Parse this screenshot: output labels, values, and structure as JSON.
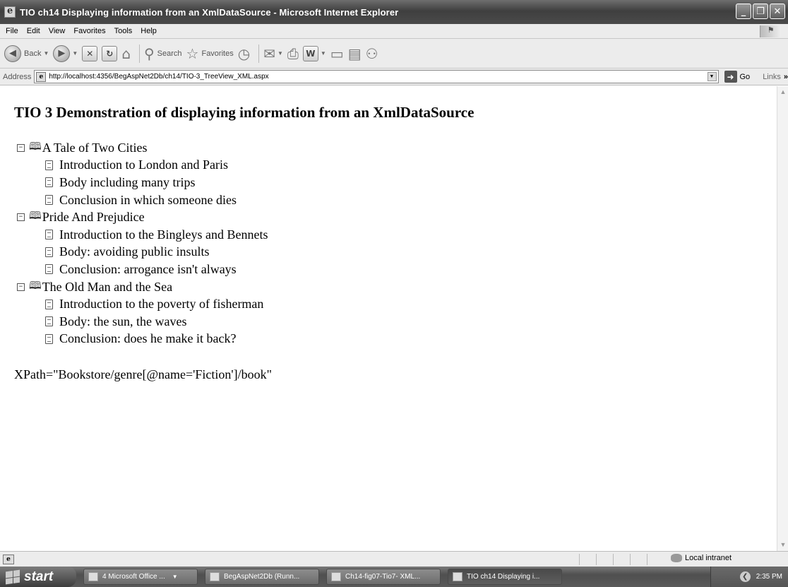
{
  "window": {
    "title": "TIO ch14 Displaying information from an XmlDataSource - Microsoft Internet Explorer",
    "buttons": {
      "minimize": "_",
      "maximize": "❐",
      "close": "✕"
    }
  },
  "menu": [
    "File",
    "Edit",
    "View",
    "Favorites",
    "Tools",
    "Help"
  ],
  "toolbar": {
    "back_label": "Back",
    "search_label": "Search",
    "favorites_label": "Favorites"
  },
  "address": {
    "label": "Address",
    "url": "http://localhost:4356/BegAspNet2Db/ch14/TIO-3_TreeView_XML.aspx",
    "go_label": "Go",
    "links_label": "Links"
  },
  "page": {
    "heading": "TIO 3 Demonstration of displaying information from an XmlDataSource",
    "tree": [
      {
        "title": "A Tale of Two Cities",
        "chapters": [
          "Introduction to London and Paris",
          "Body including many trips",
          "Conclusion in which someone dies"
        ]
      },
      {
        "title": "Pride And Prejudice",
        "chapters": [
          "Introduction to the Bingleys and Bennets",
          "Body: avoiding public insults",
          "Conclusion: arrogance isn't always"
        ]
      },
      {
        "title": "The Old Man and the Sea",
        "chapters": [
          "Introduction to the poverty of fisherman",
          "Body: the sun, the waves",
          "Conclusion: does he make it back?"
        ]
      }
    ],
    "expander_glyph": "−",
    "xpath": "XPath=\"Bookstore/genre[@name='Fiction']/book\""
  },
  "statusbar": {
    "zone": "Local intranet"
  },
  "taskbar": {
    "start_label": "start",
    "tasks": [
      {
        "label": "4 Microsoft Office ...",
        "has_dropdown": true
      },
      {
        "label": "BegAspNet2Db (Runn...",
        "has_dropdown": false
      },
      {
        "label": "Ch14-fig07-Tio7- XML...",
        "has_dropdown": false
      },
      {
        "label": "TIO ch14 Displaying i...",
        "has_dropdown": false,
        "active": true
      }
    ],
    "clock": "2:35 PM"
  }
}
